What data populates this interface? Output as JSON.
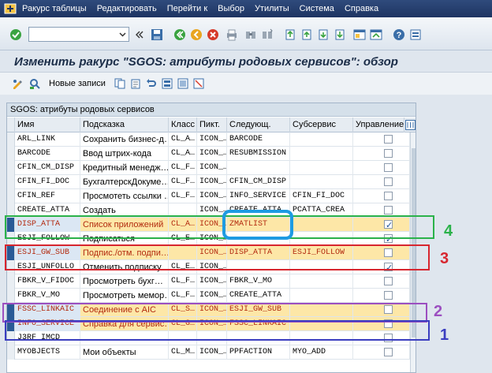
{
  "menubar": {
    "items": [
      "Ракурс таблицы",
      "Редактировать",
      "Перейти к",
      "Выбор",
      "Утилиты",
      "Система",
      "Справка"
    ]
  },
  "toolbar": {
    "command_value": "",
    "icons": [
      "enter-icon",
      "back-icon",
      "save-icon",
      "exit-icon",
      "cancel-icon",
      "print-icon",
      "find-icon",
      "find-next-icon",
      "first-page-icon",
      "prev-page-icon",
      "next-page-icon",
      "last-page-icon",
      "new-session-icon",
      "shortcut-icon",
      "help-icon",
      "customize-icon"
    ]
  },
  "title": "Изменить ракурс \"SGOS: атрибуты родовых сервисов\": обзор",
  "app_toolbar": {
    "new_entries_label": "Новые записи"
  },
  "table": {
    "title": "SGOS: атрибуты родовых сервисов",
    "columns": [
      "Имя",
      "Подсказка",
      "Класс",
      "Пикт.",
      "Следующ.",
      "Субсервис",
      "Управление"
    ],
    "rows": [
      {
        "name": "ARL_LINK",
        "hint": "Сохранить бизнес-д…",
        "cls": "CL_A…",
        "icon": "ICON_…",
        "next": "BARCODE",
        "sub": "",
        "ctrl": false,
        "hl": false
      },
      {
        "name": "BARCODE",
        "hint": "Ввод штрих-кода",
        "cls": "CL_A…",
        "icon": "ICON_…",
        "next": "RESUBMISSION",
        "sub": "",
        "ctrl": false,
        "hl": false
      },
      {
        "name": "CFIN_CM_DISP",
        "hint": "Кредитный менедж…",
        "cls": "CL_F…",
        "icon": "ICON_…",
        "next": "",
        "sub": "",
        "ctrl": false,
        "hl": false
      },
      {
        "name": "CFIN_FI_DOC",
        "hint": "БухгалтерскДокуме…",
        "cls": "CL_F…",
        "icon": "ICON_…",
        "next": "CFIN_CM_DISP",
        "sub": "",
        "ctrl": false,
        "hl": false
      },
      {
        "name": "CFIN_REF",
        "hint": "Просмотеть ссылки …",
        "cls": "CL_F…",
        "icon": "ICON_…",
        "next": "INFO_SERVICE",
        "sub": "CFIN_FI_DOC",
        "ctrl": false,
        "hl": false
      },
      {
        "name": "CREATE_ATTA",
        "hint": "Создать",
        "cls": "",
        "icon": "ICON_…",
        "next": "CREATE_ATTA",
        "sub": "PCATTA_CREA",
        "ctrl": false,
        "hl": false
      },
      {
        "name": "DISP_ATTA",
        "hint": "Список приложений",
        "cls": "CL_A…",
        "icon": "ICON_…",
        "next": "ZMATLIST",
        "sub": "",
        "ctrl": true,
        "hl": true
      },
      {
        "name": "ESJI_FOLLOW",
        "hint": "Подписаться",
        "cls": "CL_E…",
        "icon": "ICON_…",
        "next": "",
        "sub": "",
        "ctrl": true,
        "hl": false
      },
      {
        "name": "ESJI_GW_SUB",
        "hint": "Подпис./отм. подпи…",
        "cls": "",
        "icon": "ICON_…",
        "next": "DISP_ATTA",
        "sub": "ESJI_FOLLOW",
        "ctrl": false,
        "hl": true
      },
      {
        "name": "ESJI_UNFOLLO",
        "hint": "Отменить подписку",
        "cls": "CL_E…",
        "icon": "ICON_…",
        "next": "",
        "sub": "",
        "ctrl": true,
        "hl": false
      },
      {
        "name": "FBKR_V_FIDOC",
        "hint": "Просмотреть бухг…",
        "cls": "CL_F…",
        "icon": "ICON_…",
        "next": "FBKR_V_MO",
        "sub": "",
        "ctrl": false,
        "hl": false
      },
      {
        "name": "FBKR_V_MO",
        "hint": "Просмотреть мемор…",
        "cls": "CL_F…",
        "icon": "ICON_…",
        "next": "CREATE_ATTA",
        "sub": "",
        "ctrl": false,
        "hl": false
      },
      {
        "name": "FSSC_LINKAIC",
        "hint": "Соединение с AIC",
        "cls": "CL_S…",
        "icon": "ICON_…",
        "next": "ESJI_GW_SUB",
        "sub": "",
        "ctrl": false,
        "hl": true
      },
      {
        "name": "INFO_SERVICE",
        "hint": "Справка для сервис…",
        "cls": "CL_G…",
        "icon": "ICON_…",
        "next": "FSSC_LINKAIC",
        "sub": "",
        "ctrl": false,
        "hl": true
      },
      {
        "name": "J3RF_IMCD",
        "hint": "",
        "cls": "",
        "icon": "",
        "next": "",
        "sub": "",
        "ctrl": false,
        "hl": false
      },
      {
        "name": "MYOBJECTS",
        "hint": "Мои объекты",
        "cls": "CL_M…",
        "icon": "ICON_…",
        "next": "PPFACTION",
        "sub": "MYO_ADD",
        "ctrl": false,
        "hl": false
      }
    ]
  },
  "annotations": {
    "labels": [
      "4",
      "3",
      "2",
      "1"
    ],
    "colors": {
      "green": "#2bb24a",
      "red": "#d7262f",
      "purple": "#9c4fc0",
      "blue": "#3b3ec0",
      "circle": "#1e9be2"
    }
  }
}
